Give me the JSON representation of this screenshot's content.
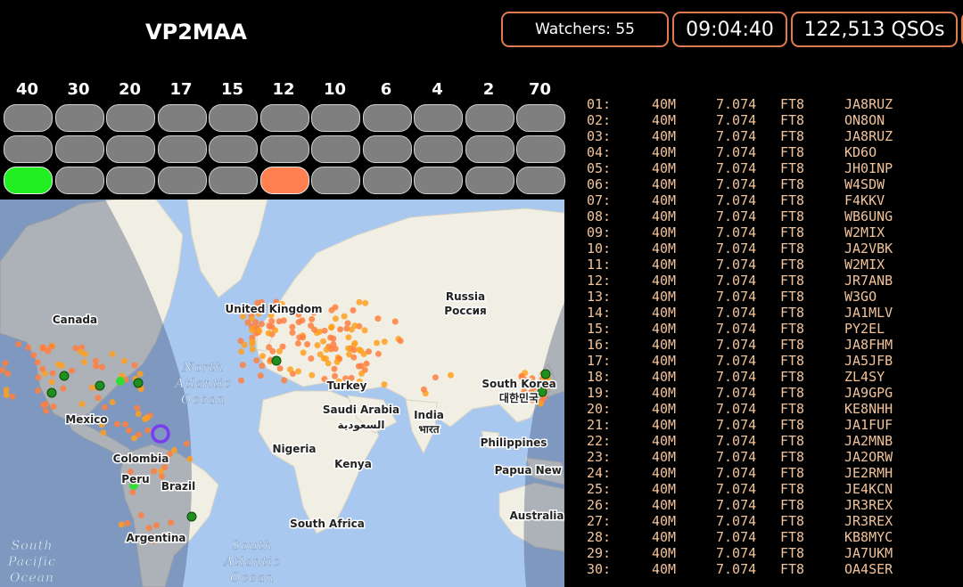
{
  "header": {
    "callsign": "VP2MAA",
    "watchers": "Watchers: 55",
    "clock": "09:04:40",
    "qsos_count": "122,513",
    "qsos_unit": "QSOs"
  },
  "bands": [
    "40",
    "30",
    "20",
    "17",
    "15",
    "12",
    "10",
    "6",
    "4",
    "2",
    "70"
  ],
  "band_grid": {
    "rows": [
      [
        "off",
        "off",
        "off",
        "off",
        "off",
        "off",
        "off",
        "off",
        "off",
        "off",
        "off"
      ],
      [
        "off",
        "off",
        "off",
        "off",
        "off",
        "off",
        "off",
        "off",
        "off",
        "off",
        "off"
      ],
      [
        "active-green",
        "off",
        "off",
        "off",
        "off",
        "active-orange",
        "off",
        "off",
        "off",
        "off",
        "off"
      ]
    ],
    "colors": {
      "off": "#7f7f7f",
      "active-green": "#22ee22",
      "active-orange": "#ff7f50"
    }
  },
  "map": {
    "countries": [
      "Canada",
      "United Kingdom",
      "Russia",
      "Россия",
      "Turkey",
      "Saudi Arabia",
      "السعودية",
      "India",
      "भारत",
      "South Korea",
      "대한민국",
      "Mexico",
      "Colombia",
      "Peru",
      "Brazil",
      "Argentina",
      "Nigeria",
      "Kenya",
      "South Africa",
      "Philippines",
      "Papua New Guinea",
      "Australia"
    ],
    "oceans": [
      "North Atlantic Ocean",
      "South Pacific Ocean",
      "South Atlantic Ocean"
    ],
    "marker_colors": {
      "spot": "#ff7f40",
      "spot_alt": "#ffa020",
      "green": "#1f8f1f",
      "green_light": "#33dd33",
      "station": "#7a3cf0"
    }
  },
  "qso_list": [
    [
      "01:",
      "40M",
      "7.074",
      "FT8",
      "JA8RUZ"
    ],
    [
      "02:",
      "40M",
      "7.074",
      "FT8",
      "ON8ON"
    ],
    [
      "03:",
      "40M",
      "7.074",
      "FT8",
      "JA8RUZ"
    ],
    [
      "04:",
      "40M",
      "7.074",
      "FT8",
      "KD6O"
    ],
    [
      "05:",
      "40M",
      "7.074",
      "FT8",
      "JH0INP"
    ],
    [
      "06:",
      "40M",
      "7.074",
      "FT8",
      "W4SDW"
    ],
    [
      "07:",
      "40M",
      "7.074",
      "FT8",
      "F4KKV"
    ],
    [
      "08:",
      "40M",
      "7.074",
      "FT8",
      "WB6UNG"
    ],
    [
      "09:",
      "40M",
      "7.074",
      "FT8",
      "W2MIX"
    ],
    [
      "10:",
      "40M",
      "7.074",
      "FT8",
      "JA2VBK"
    ],
    [
      "11:",
      "40M",
      "7.074",
      "FT8",
      "W2MIX"
    ],
    [
      "12:",
      "40M",
      "7.074",
      "FT8",
      "JR7ANB"
    ],
    [
      "13:",
      "40M",
      "7.074",
      "FT8",
      "W3GO"
    ],
    [
      "14:",
      "40M",
      "7.074",
      "FT8",
      "JA1MLV"
    ],
    [
      "15:",
      "40M",
      "7.074",
      "FT8",
      "PY2EL"
    ],
    [
      "16:",
      "40M",
      "7.074",
      "FT8",
      "JA8FHM"
    ],
    [
      "17:",
      "40M",
      "7.074",
      "FT8",
      "JA5JFB"
    ],
    [
      "18:",
      "40M",
      "7.074",
      "FT8",
      "ZL4SY"
    ],
    [
      "19:",
      "40M",
      "7.074",
      "FT8",
      "JA9GPG"
    ],
    [
      "20:",
      "40M",
      "7.074",
      "FT8",
      "KE8NHH"
    ],
    [
      "21:",
      "40M",
      "7.074",
      "FT8",
      "JA1FUF"
    ],
    [
      "22:",
      "40M",
      "7.074",
      "FT8",
      "JA2MNB"
    ],
    [
      "23:",
      "40M",
      "7.074",
      "FT8",
      "JA2ORW"
    ],
    [
      "24:",
      "40M",
      "7.074",
      "FT8",
      "JE2RMH"
    ],
    [
      "25:",
      "40M",
      "7.074",
      "FT8",
      "JE4KCN"
    ],
    [
      "26:",
      "40M",
      "7.074",
      "FT8",
      "JR3REX"
    ],
    [
      "27:",
      "40M",
      "7.074",
      "FT8",
      "JR3REX"
    ],
    [
      "28:",
      "40M",
      "7.074",
      "FT8",
      "KB8MYC"
    ],
    [
      "29:",
      "40M",
      "7.074",
      "FT8",
      "JA7UKM"
    ],
    [
      "30:",
      "40M",
      "7.074",
      "FT8",
      "OA4SER"
    ]
  ]
}
